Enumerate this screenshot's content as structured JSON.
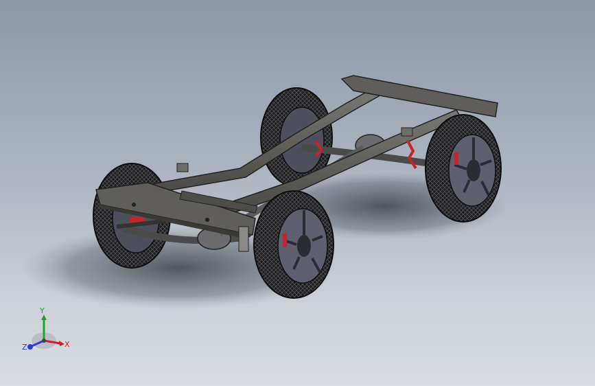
{
  "view": {
    "background_top": "#8c97a8",
    "background_bottom": "#d9dde3"
  },
  "triad": {
    "x_label": "X",
    "y_label": "Y",
    "z_label": "Z",
    "x_color": "#d11f1f",
    "y_color": "#1fa12a",
    "z_color": "#2a3fd1"
  },
  "model": {
    "frame_color": "#5b5a57",
    "tire_color": "#1e1e20",
    "rim_color": "#5e6070",
    "accent_color": "#c0262a",
    "icon": "chassis-3d-model"
  }
}
